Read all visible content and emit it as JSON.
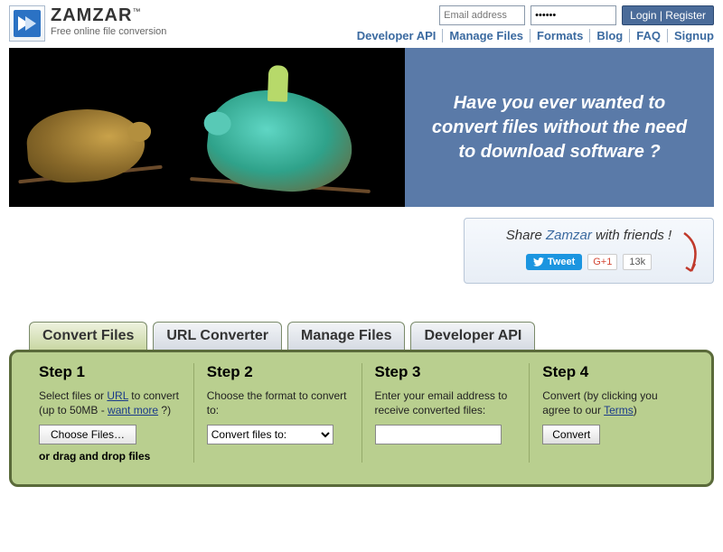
{
  "logo": {
    "brand": "ZAMZAR",
    "tagline": "Free online file conversion"
  },
  "auth": {
    "email_placeholder": "Email address",
    "password_value": "••••••",
    "login_label": "Login | Register"
  },
  "nav": {
    "developer_api": "Developer API",
    "manage_files": "Manage Files",
    "formats": "Formats",
    "blog": "Blog",
    "faq": "FAQ",
    "signup": "Signup"
  },
  "hero": {
    "headline": "Have you ever wanted to convert files without the need to download software ?"
  },
  "share": {
    "prefix": "Share ",
    "brand": "Zamzar",
    "suffix": " with friends !",
    "tweet": "Tweet",
    "gplus": "G+1",
    "count": "13k"
  },
  "tabs": {
    "convert_files": "Convert Files",
    "url_converter": "URL Converter",
    "manage_files": "Manage Files",
    "developer_api": "Developer API"
  },
  "steps": {
    "s1": {
      "title": "Step 1",
      "text_a": "Select files or ",
      "url": "URL",
      "text_b": " to convert (up to 50MB - ",
      "want_more": "want more",
      "text_c": " ?)",
      "choose": "Choose Files…",
      "drag": "or drag and drop files"
    },
    "s2": {
      "title": "Step 2",
      "text": "Choose the format to convert to:",
      "select_label": "Convert files to:"
    },
    "s3": {
      "title": "Step 3",
      "text": "Enter your email address to receive converted files:"
    },
    "s4": {
      "title": "Step 4",
      "text_a": "Convert (by clicking you agree to our ",
      "terms": "Terms",
      "text_b": ")",
      "button": "Convert"
    }
  }
}
